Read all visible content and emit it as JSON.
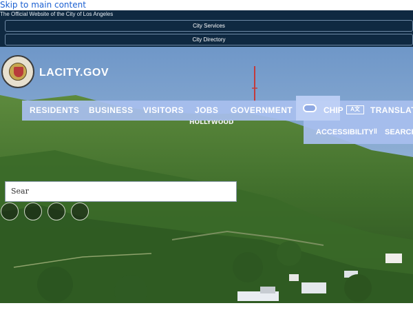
{
  "skip_link": "Skip to main content",
  "official_notice": "The Official Website of the City of Los Angeles",
  "top_buttons": {
    "city_services": "City Services",
    "city_directory": "City Directory"
  },
  "header": {
    "site_name": "LACITY.GOV",
    "seal_icon": "city-seal-icon"
  },
  "main_nav": {
    "items": [
      "RESIDENTS",
      "BUSINESS",
      "VISITORS",
      "JOBS",
      "GOVERNMENT"
    ],
    "chip": "CHIP",
    "translate": "TRANSLATE",
    "translate_icon_text": "A文"
  },
  "sub_nav": {
    "accessibility": "ACCESSIBILITY",
    "search": "SEARCH"
  },
  "search": {
    "value": "Sear"
  },
  "colors": {
    "official_bar": "#0f2941",
    "nav_background": "#a8beee",
    "link": "#1a5fd1"
  }
}
